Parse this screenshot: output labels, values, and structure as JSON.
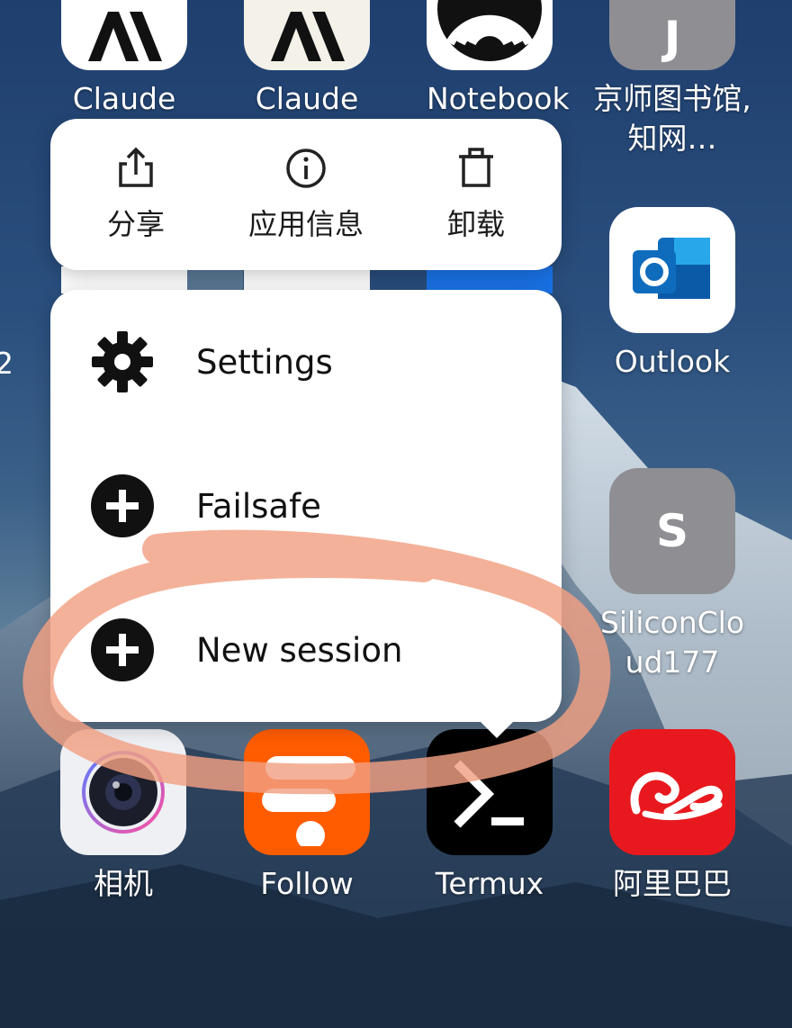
{
  "apps": {
    "claude_1": {
      "label": "Claude",
      "icon": "claude-logo-icon"
    },
    "claude_2": {
      "label": "Claude",
      "icon": "claude-logo-icon"
    },
    "notebook": {
      "label": "Notebook",
      "icon": "notebook-logo-icon"
    },
    "jingshi": {
      "label": "京师图书馆,知网…",
      "letter": "J",
      "color": "#8e8e93"
    },
    "outlook": {
      "label": "Outlook",
      "icon": "outlook-icon",
      "color": "#0f6cbd"
    },
    "siliconcloud": {
      "label": "SiliconCloud177",
      "letter": "S",
      "color": "#8e8e93"
    },
    "camera": {
      "label": "相机",
      "icon": "camera-lens-icon"
    },
    "follow": {
      "label": "Follow",
      "icon": "follow-logo-icon",
      "color": "#ff5c00"
    },
    "termux": {
      "label": "Termux",
      "icon": "terminal-prompt-icon"
    },
    "alibaba": {
      "label": "阿里巴巴",
      "icon": "alibaba-logo-icon",
      "color": "#e8191e"
    },
    "left_edge_label": "2"
  },
  "shortcut_bar": {
    "share": {
      "label": "分享",
      "icon": "share-icon"
    },
    "app_info": {
      "label": "应用信息",
      "icon": "info-icon"
    },
    "uninstall": {
      "label": "卸载",
      "icon": "trash-icon"
    }
  },
  "context_menu": {
    "items": [
      {
        "label": "Settings",
        "icon": "gear-icon"
      },
      {
        "label": "Failsafe",
        "icon": "plus-circle-icon"
      },
      {
        "label": "New session",
        "icon": "plus-circle-icon"
      }
    ]
  },
  "annotation": {
    "shape": "hand-drawn-ellipse",
    "color": "#f2a082",
    "target": "New session"
  }
}
